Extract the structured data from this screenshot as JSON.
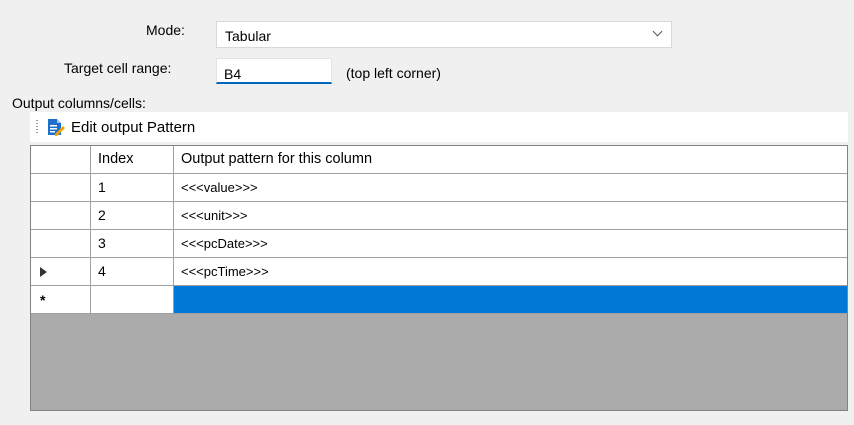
{
  "form": {
    "mode_label": "Mode:",
    "mode_value": "Tabular",
    "target_label": "Target cell range:",
    "target_value": "B4",
    "target_hint": "(top left corner)",
    "output_label": "Output columns/cells:"
  },
  "toolbar": {
    "edit_pattern_label": "Edit output Pattern",
    "edit_pattern_icon": "edit-document-icon"
  },
  "grid": {
    "columns": [
      "Index",
      "Output pattern for this column"
    ],
    "rows": [
      {
        "index": "1",
        "pattern": "<<<value>>>"
      },
      {
        "index": "2",
        "pattern": "<<<unit>>>"
      },
      {
        "index": "3",
        "pattern": "<<<pcDate>>>"
      },
      {
        "index": "4",
        "pattern": "<<<pcTime>>>"
      }
    ],
    "new_row_marker": "*",
    "selection_color": "#0078d7"
  }
}
